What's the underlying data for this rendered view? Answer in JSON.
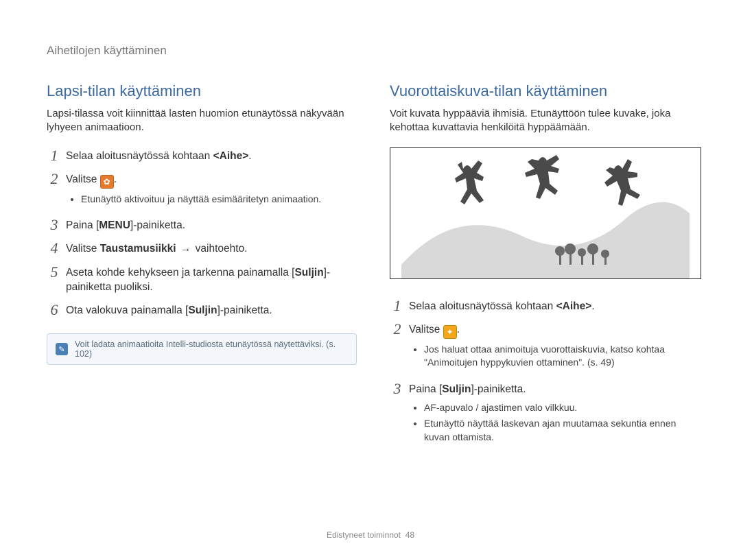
{
  "breadcrumb": "Aihetilojen käyttäminen",
  "left": {
    "heading": "Lapsi-tilan käyttäminen",
    "lead": "Lapsi-tilassa voit kiinnittää lasten huomion etunäytössä näkyvään lyhyeen animaatioon.",
    "steps": [
      {
        "n": "1",
        "text_pre": "Selaa aloitusnäytössä kohtaan ",
        "bold": "<Aihe>",
        "text_post": "."
      },
      {
        "n": "2",
        "text_pre": "Valitse ",
        "icon": "orange",
        "icon_glyph": "✿",
        "text_post": ".",
        "sub": [
          "Etunäyttö aktivoituu ja näyttää esimääritetyn animaation."
        ]
      },
      {
        "n": "3",
        "text_pre": "Paina [",
        "menu": "MENU",
        "text_post": "]-painiketta."
      },
      {
        "n": "4",
        "text_pre": "Valitse ",
        "bold": "Taustamusiikki",
        "arrow": " → ",
        "text_post": " vaihtoehto."
      },
      {
        "n": "5",
        "text_pre": "Aseta kohde kehykseen ja tarkenna painamalla [",
        "bold": "Suljin",
        "text_post": "]-painiketta puoliksi."
      },
      {
        "n": "6",
        "text_pre": "Ota valokuva painamalla [",
        "bold": "Suljin",
        "text_post": "]-painiketta."
      }
    ],
    "note": "Voit ladata animaatioita Intelli-studiosta etunäytössä näytettäviksi. (s. 102)"
  },
  "right": {
    "heading": "Vuorottaiskuva-tilan käyttäminen",
    "lead": "Voit kuvata hyppääviä ihmisiä. Etunäyttöön tulee kuvake, joka kehottaa kuvattavia henkilöitä hyppäämään.",
    "illustration_alt": "silhouette-jumping-people",
    "steps": [
      {
        "n": "1",
        "text_pre": "Selaa aloitusnäytössä kohtaan ",
        "bold": "<Aihe>",
        "text_post": "."
      },
      {
        "n": "2",
        "text_pre": "Valitse ",
        "icon": "yellow",
        "icon_glyph": "✦",
        "text_post": ".",
        "sub": [
          "Jos haluat ottaa animoituja vuorottaiskuvia, katso kohtaa \"Animoitujen hyppykuvien ottaminen\". (s. 49)"
        ]
      },
      {
        "n": "3",
        "text_pre": "Paina [",
        "bold": "Suljin",
        "text_post": "]-painiketta.",
        "sub": [
          "AF-apuvalo / ajastimen valo vilkkuu.",
          "Etunäyttö näyttää laskevan ajan muutamaa sekuntia ennen kuvan ottamista."
        ]
      }
    ]
  },
  "footer_section": "Edistyneet toiminnot",
  "footer_page": "48"
}
